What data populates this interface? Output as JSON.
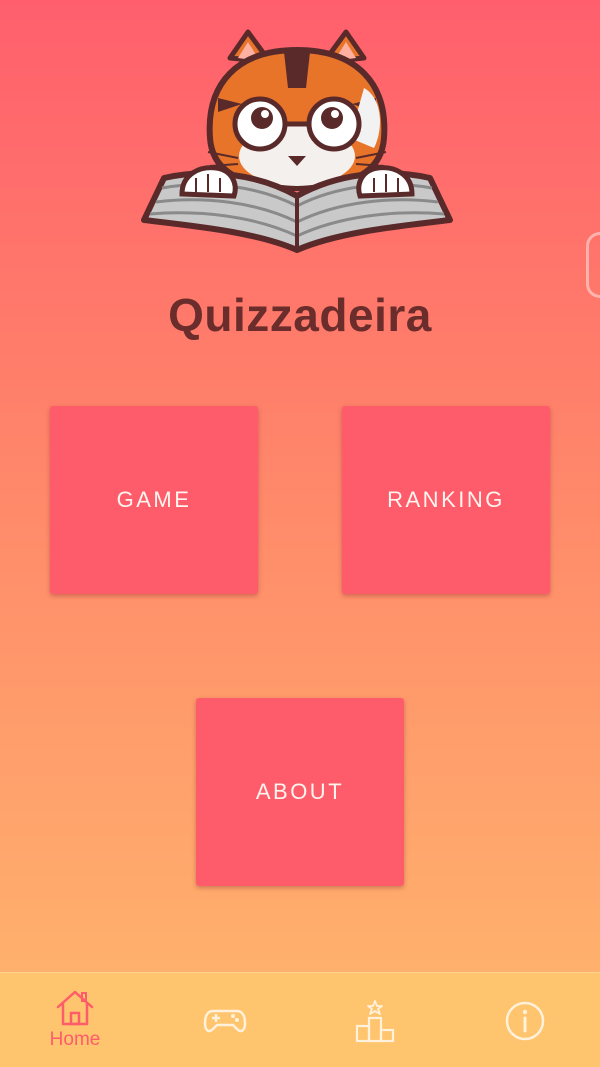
{
  "app": {
    "title": "Quizzadeira",
    "logo_icon": "cat-reading-book-icon"
  },
  "menu": {
    "game_label": "GAME",
    "ranking_label": "RANKING",
    "about_label": "ABOUT"
  },
  "bottom_nav": {
    "items": [
      {
        "label": "Home",
        "icon": "home-icon",
        "active": true
      },
      {
        "label": "",
        "icon": "gamepad-icon",
        "active": false
      },
      {
        "label": "",
        "icon": "podium-icon",
        "active": false
      },
      {
        "label": "",
        "icon": "info-icon",
        "active": false
      }
    ]
  },
  "colors": {
    "gradient_top": "#ff5f6d",
    "gradient_bottom": "#ffb86d",
    "button": "#ff5c6b",
    "title": "#6b2c2c",
    "nav_bg": "#ffc56e",
    "nav_active": "#ff5c6b",
    "nav_inactive": "#fff1dc"
  }
}
